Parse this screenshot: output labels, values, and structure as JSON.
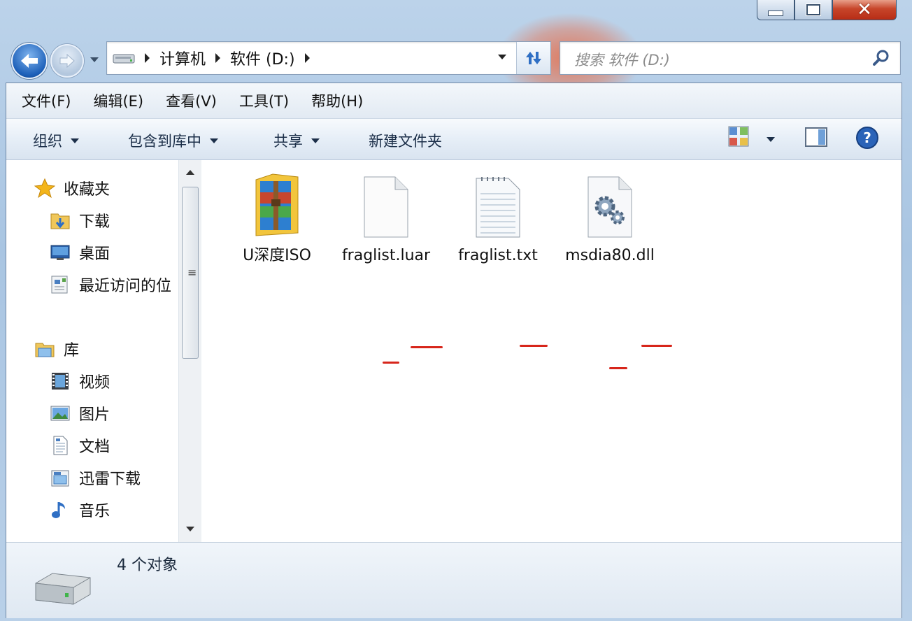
{
  "address": {
    "crumbs": [
      "计算机",
      "软件 (D:)"
    ]
  },
  "search": {
    "placeholder": "搜索 软件 (D:)"
  },
  "menu": [
    "文件(F)",
    "编辑(E)",
    "查看(V)",
    "工具(T)",
    "帮助(H)"
  ],
  "commands": {
    "organize": "组织",
    "include_library": "包含到库中",
    "share": "共享",
    "new_folder": "新建文件夹"
  },
  "nav": {
    "favorites_header": "收藏夹",
    "favorites": [
      "下载",
      "桌面",
      "最近访问的位"
    ],
    "libraries_header": "库",
    "libraries": [
      "视频",
      "图片",
      "文档",
      "迅雷下载",
      "音乐"
    ]
  },
  "files": [
    {
      "name": "U深度ISO",
      "icon": "winrar-archive-icon"
    },
    {
      "name": "fraglist.luar",
      "icon": "blank-file-icon"
    },
    {
      "name": "fraglist.txt",
      "icon": "text-file-icon"
    },
    {
      "name": "msdia80.dll",
      "icon": "dll-gear-file-icon"
    }
  ],
  "status": {
    "count": "4 个对象"
  },
  "colors": {
    "annotation_underline": "#d7261b",
    "back_button": "#1c5fb8",
    "close_button": "#c7452a"
  }
}
